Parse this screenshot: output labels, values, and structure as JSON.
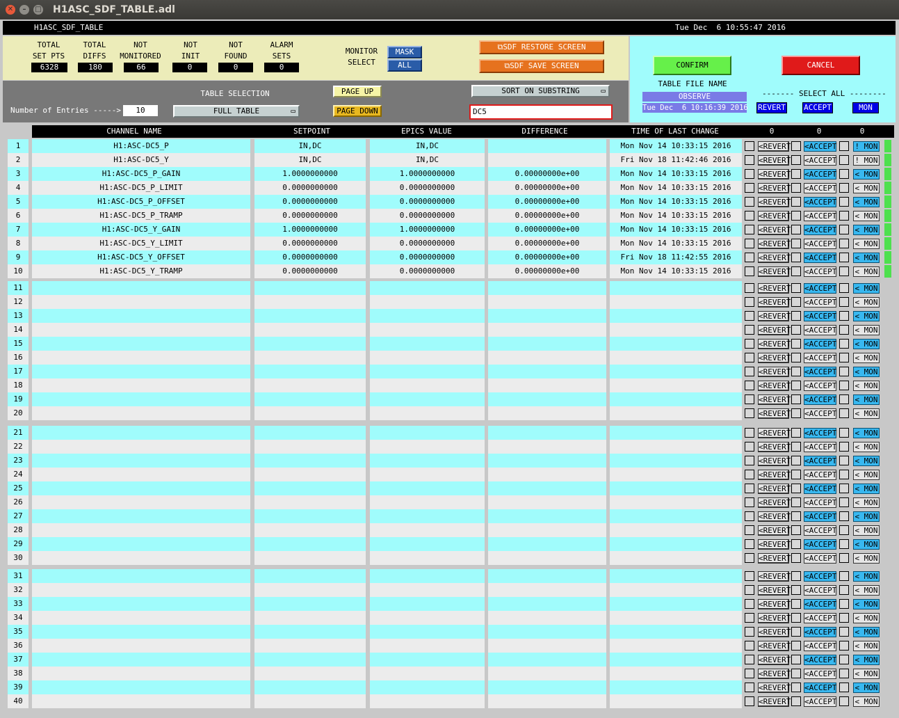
{
  "window": {
    "title": "H1ASC_SDF_TABLE.adl"
  },
  "topbar": {
    "name": "H1ASC_SDF_TABLE",
    "time": "Tue Dec  6 10:55:47 2016"
  },
  "stats": [
    {
      "l1": "TOTAL",
      "l2": "SET PTS",
      "value": "6328"
    },
    {
      "l1": "TOTAL",
      "l2": "DIFFS",
      "value": "180"
    },
    {
      "l1": "NOT",
      "l2": "MONITORED",
      "value": "66"
    },
    {
      "l1": "NOT",
      "l2": "INIT",
      "value": "0"
    },
    {
      "l1": "NOT",
      "l2": "FOUND",
      "value": "0"
    },
    {
      "l1": "ALARM",
      "l2": "SETS",
      "value": "0"
    }
  ],
  "monitor": {
    "l1": "MONITOR",
    "l2": "SELECT",
    "mask": "MASK",
    "all": "ALL"
  },
  "sdf": {
    "restore": "SDF RESTORE SCREEN",
    "save": "SDF SAVE SCREEN"
  },
  "confirm": {
    "confirm": "CONFIRM",
    "cancel": "CANCEL",
    "table_file_label": "TABLE FILE NAME",
    "table_file": "OBSERVE",
    "file_time": "Tue Dec  6 10:16:39 2016",
    "select_all": "------- SELECT ALL --------",
    "revert": "REVERT",
    "accept": "ACCEPT",
    "mon": "MON"
  },
  "controls": {
    "table_selection_label": "TABLE SELECTION",
    "table_selection_value": "FULL TABLE",
    "page_up": "PAGE UP",
    "page_down": "PAGE DOWN",
    "sort_label": "SORT ON SUBSTRING",
    "sort_value": "DC5",
    "entries_label": "Number of Entries ----->",
    "entries_value": "10"
  },
  "columns": {
    "channel": "CHANNEL NAME",
    "setpoint": "SETPOINT",
    "epics": "EPICS VALUE",
    "diff": "DIFFERENCE",
    "time": "TIME OF LAST CHANGE",
    "count_revert": "0",
    "count_accept": "0",
    "count_mon": "0"
  },
  "row_buttons": {
    "revert": "<REVERT",
    "accept": "<ACCEPT",
    "mon_lt": "< MON",
    "mon_bang": "! MON"
  },
  "row_numbers": [
    "1",
    "2",
    "3",
    "4",
    "5",
    "6",
    "7",
    "8",
    "9",
    "10",
    "11",
    "12",
    "13",
    "14",
    "15",
    "16",
    "17",
    "18",
    "19",
    "20",
    "21",
    "22",
    "23",
    "24",
    "25",
    "26",
    "27",
    "28",
    "29",
    "30",
    "31",
    "32",
    "33",
    "34",
    "35",
    "36",
    "37",
    "38",
    "39",
    "40"
  ],
  "rows": [
    {
      "channel": "H1:ASC-DC5_P",
      "setpoint": "IN,DC",
      "epics": "IN,DC",
      "diff": "",
      "time": "Mon Nov 14 10:33:15 2016",
      "mon": "! MON"
    },
    {
      "channel": "H1:ASC-DC5_Y",
      "setpoint": "IN,DC",
      "epics": "IN,DC",
      "diff": "",
      "time": "Fri Nov 18 11:42:46 2016",
      "mon": "! MON"
    },
    {
      "channel": "H1:ASC-DC5_P_GAIN",
      "setpoint": "1.0000000000",
      "epics": "1.0000000000",
      "diff": "0.00000000e+00",
      "time": "Mon Nov 14 10:33:15 2016",
      "mon": "< MON"
    },
    {
      "channel": "H1:ASC-DC5_P_LIMIT",
      "setpoint": "0.0000000000",
      "epics": "0.0000000000",
      "diff": "0.00000000e+00",
      "time": "Mon Nov 14 10:33:15 2016",
      "mon": "< MON"
    },
    {
      "channel": "H1:ASC-DC5_P_OFFSET",
      "setpoint": "0.0000000000",
      "epics": "0.0000000000",
      "diff": "0.00000000e+00",
      "time": "Mon Nov 14 10:33:15 2016",
      "mon": "< MON"
    },
    {
      "channel": "H1:ASC-DC5_P_TRAMP",
      "setpoint": "0.0000000000",
      "epics": "0.0000000000",
      "diff": "0.00000000e+00",
      "time": "Mon Nov 14 10:33:15 2016",
      "mon": "< MON"
    },
    {
      "channel": "H1:ASC-DC5_Y_GAIN",
      "setpoint": "1.0000000000",
      "epics": "1.0000000000",
      "diff": "0.00000000e+00",
      "time": "Mon Nov 14 10:33:15 2016",
      "mon": "< MON"
    },
    {
      "channel": "H1:ASC-DC5_Y_LIMIT",
      "setpoint": "0.0000000000",
      "epics": "0.0000000000",
      "diff": "0.00000000e+00",
      "time": "Mon Nov 14 10:33:15 2016",
      "mon": "< MON"
    },
    {
      "channel": "H1:ASC-DC5_Y_OFFSET",
      "setpoint": "0.0000000000",
      "epics": "0.0000000000",
      "diff": "0.00000000e+00",
      "time": "Fri Nov 18 11:42:55 2016",
      "mon": "< MON"
    },
    {
      "channel": "H1:ASC-DC5_Y_TRAMP",
      "setpoint": "0.0000000000",
      "epics": "0.0000000000",
      "diff": "0.00000000e+00",
      "time": "Mon Nov 14 10:33:15 2016",
      "mon": "< MON"
    }
  ],
  "colors": {
    "cyan_row": "#a0fcfc",
    "light_row": "#ececec",
    "accent_orange": "#e6721e",
    "confirm_green": "#66f04a",
    "cancel_red": "#e01a1a"
  }
}
